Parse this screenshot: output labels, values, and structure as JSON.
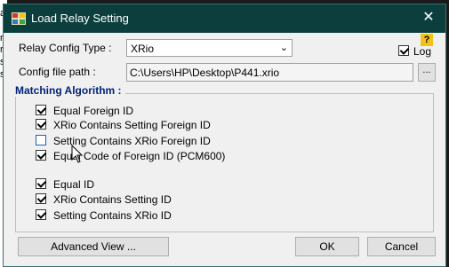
{
  "background": {
    "text_lines": [
      "a",
      "rd",
      "rd",
      "se",
      "se"
    ]
  },
  "window": {
    "title": "Load Relay Setting",
    "close_glyph": "✕",
    "help_glyph": "?"
  },
  "form": {
    "relay_config_label": "Relay Config Type :",
    "relay_config_value": "XRio",
    "log_label": "Log",
    "log_checked": true,
    "config_path_label": "Config file path :",
    "config_path_value": "C:\\Users\\HP\\Desktop\\P441.xrio",
    "browse_label": "..."
  },
  "group": {
    "title": "Matching Algorithm :",
    "items": [
      {
        "label": "Equal Foreign ID",
        "checked": true
      },
      {
        "label": "XRio Contains Setting Foreign ID",
        "checked": true
      },
      {
        "label": "Setting Contains XRio Foreign ID",
        "checked": false
      },
      {
        "label": "Equal Code of Foreign ID (PCM600)",
        "checked": true
      },
      {
        "label": "Equal ID",
        "checked": true
      },
      {
        "label": "XRio Contains Setting ID",
        "checked": true
      },
      {
        "label": "Setting Contains XRio ID",
        "checked": true
      }
    ]
  },
  "buttons": {
    "advanced": "Advanced View ...",
    "ok": "OK",
    "cancel": "Cancel"
  },
  "colors": {
    "titlebar": "#0c3e3e",
    "group_title": "#00227a",
    "help_badge": "#f2c21b"
  }
}
